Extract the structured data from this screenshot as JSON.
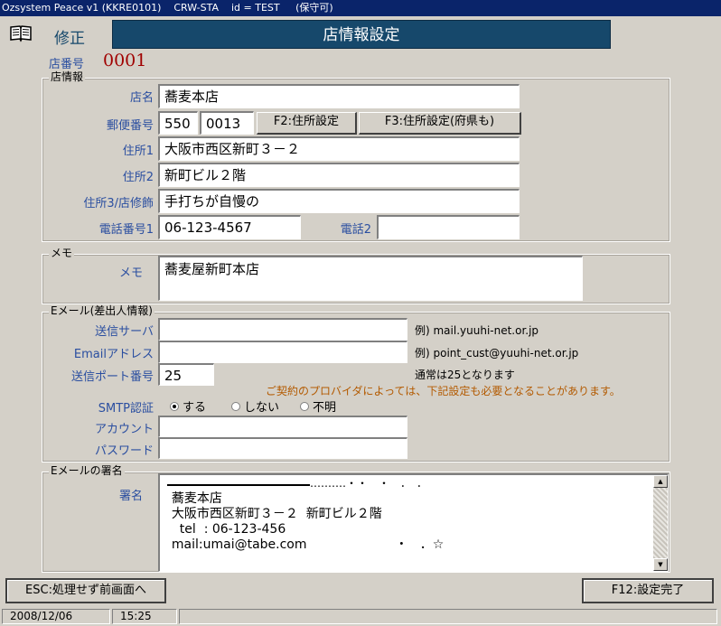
{
  "window": {
    "title": "Ozsystem Peace v1 (KKRE0101)    CRW-STA    id = TEST     (保守可)"
  },
  "header": {
    "mode": "修正",
    "title": "店情報設定"
  },
  "store_number": {
    "label": "店番号",
    "value": "0001"
  },
  "store_info": {
    "group_title": "店情報",
    "name": {
      "label": "店名",
      "value": "蕎麦本店"
    },
    "postal": {
      "label": "郵便番号",
      "part1": "550",
      "part2": "0013"
    },
    "btn_address": "F2:住所設定",
    "btn_address_pref": "F3:住所設定(府県も)",
    "address1": {
      "label": "住所1",
      "value": "大阪市西区新町３－２"
    },
    "address2": {
      "label": "住所2",
      "value": "新町ビル２階"
    },
    "address3": {
      "label": "住所3/店修飾",
      "value": "手打ちが自慢の"
    },
    "phone1": {
      "label": "電話番号1",
      "value": "06-123-4567"
    },
    "phone2": {
      "label": "電話2",
      "value": ""
    }
  },
  "memo": {
    "group_title": "メモ",
    "label": "メモ",
    "value": "蕎麦屋新町本店"
  },
  "email": {
    "group_title": "Eメール(差出人情報)",
    "server": {
      "label": "送信サーバ",
      "value": "",
      "example": "例) mail.yuuhi-net.or.jp"
    },
    "address": {
      "label": "Emailアドレス",
      "value": "",
      "example": "例) point_cust@yuuhi-net.or.jp"
    },
    "port": {
      "label": "送信ポート番号",
      "value": "25",
      "note": "通常は25となります"
    },
    "provider_note": "ご契約のプロバイダによっては、下記設定も必要となることがあります。",
    "smtp": {
      "label": "SMTP認証",
      "options": [
        "する",
        "しない",
        "不明"
      ],
      "selected": "する"
    },
    "account": {
      "label": "アカウント",
      "value": ""
    },
    "password": {
      "label": "パスワード",
      "value": ""
    }
  },
  "signature": {
    "group_title": "Eメールの署名",
    "label": "署名",
    "dots": "……‥‥・・　・　．　．",
    "lines": [
      "  蕎麦本店",
      "  大阪市西区新町３－２  新町ビル２階",
      "    tel  : 06-123-456",
      "  mail:umai@tabe.com                      ・   ．☆"
    ]
  },
  "footer": {
    "esc_button": "ESC:処理せず前画面へ",
    "f12_button": "F12:設定完了"
  },
  "statusbar": {
    "date": "2008/12/06",
    "time": "15:25"
  }
}
